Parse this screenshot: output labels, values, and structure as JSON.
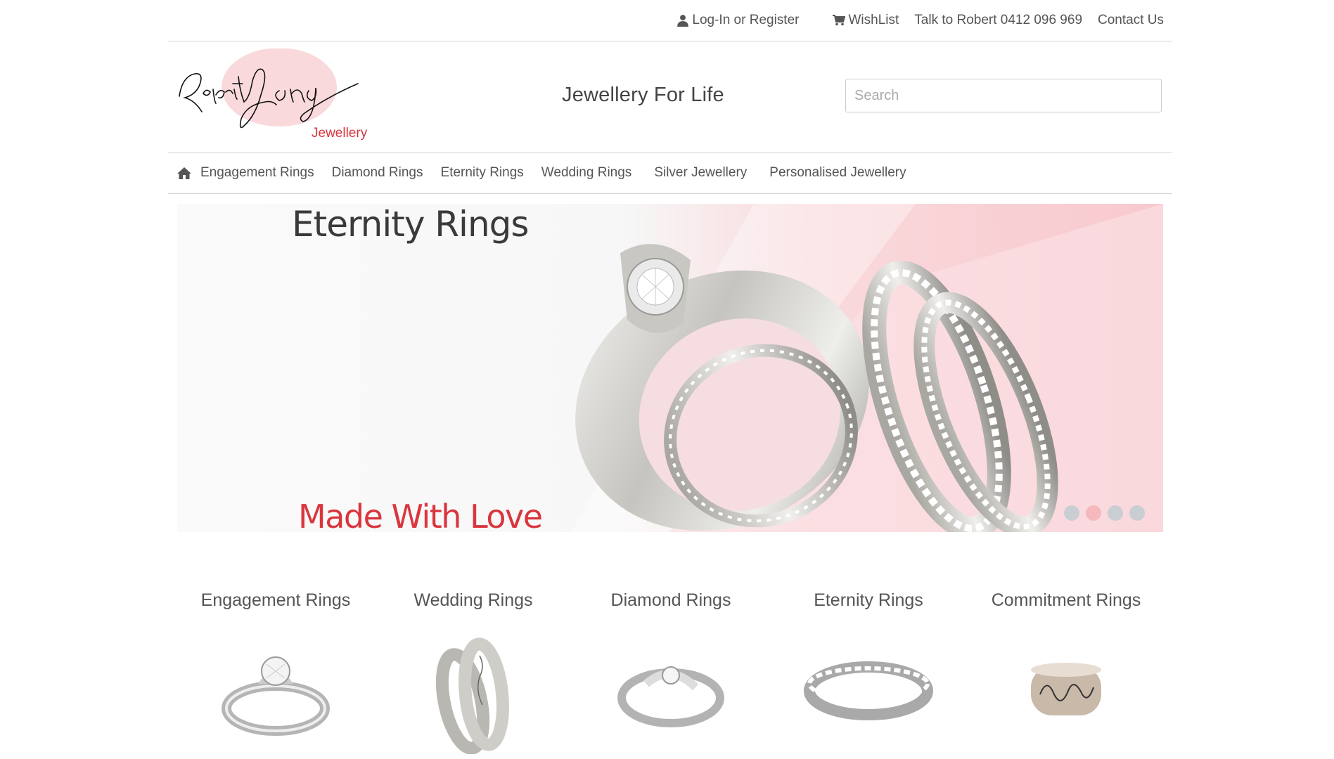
{
  "topbar": {
    "login": "Log-In or Register",
    "wishlist": "WishList",
    "phone": "Talk to Robert 0412 096 969",
    "contact": "Contact Us"
  },
  "header": {
    "logo_text": "Robert Young",
    "logo_sub": "Jewellery",
    "tagline": "Jewellery For Life",
    "search_placeholder": "Search"
  },
  "nav": {
    "items": [
      {
        "label": "Engagement Rings"
      },
      {
        "label": "Diamond Rings"
      },
      {
        "label": "Eternity Rings"
      },
      {
        "label": "Wedding Rings"
      },
      {
        "label": "Silver Jewellery"
      },
      {
        "label": "Personalised Jewellery"
      }
    ]
  },
  "banner": {
    "title": "Eternity Rings",
    "subtitle": "Made With Love",
    "slide_count": 4,
    "active_slide": 2
  },
  "categories": [
    {
      "title": "Engagement Rings"
    },
    {
      "title": "Wedding Rings"
    },
    {
      "title": "Diamond Rings"
    },
    {
      "title": "Eternity Rings"
    },
    {
      "title": "Commitment Rings"
    }
  ],
  "colors": {
    "accent_red": "#d9363e",
    "banner_pink": "#f8cfd3",
    "text": "#555555"
  }
}
